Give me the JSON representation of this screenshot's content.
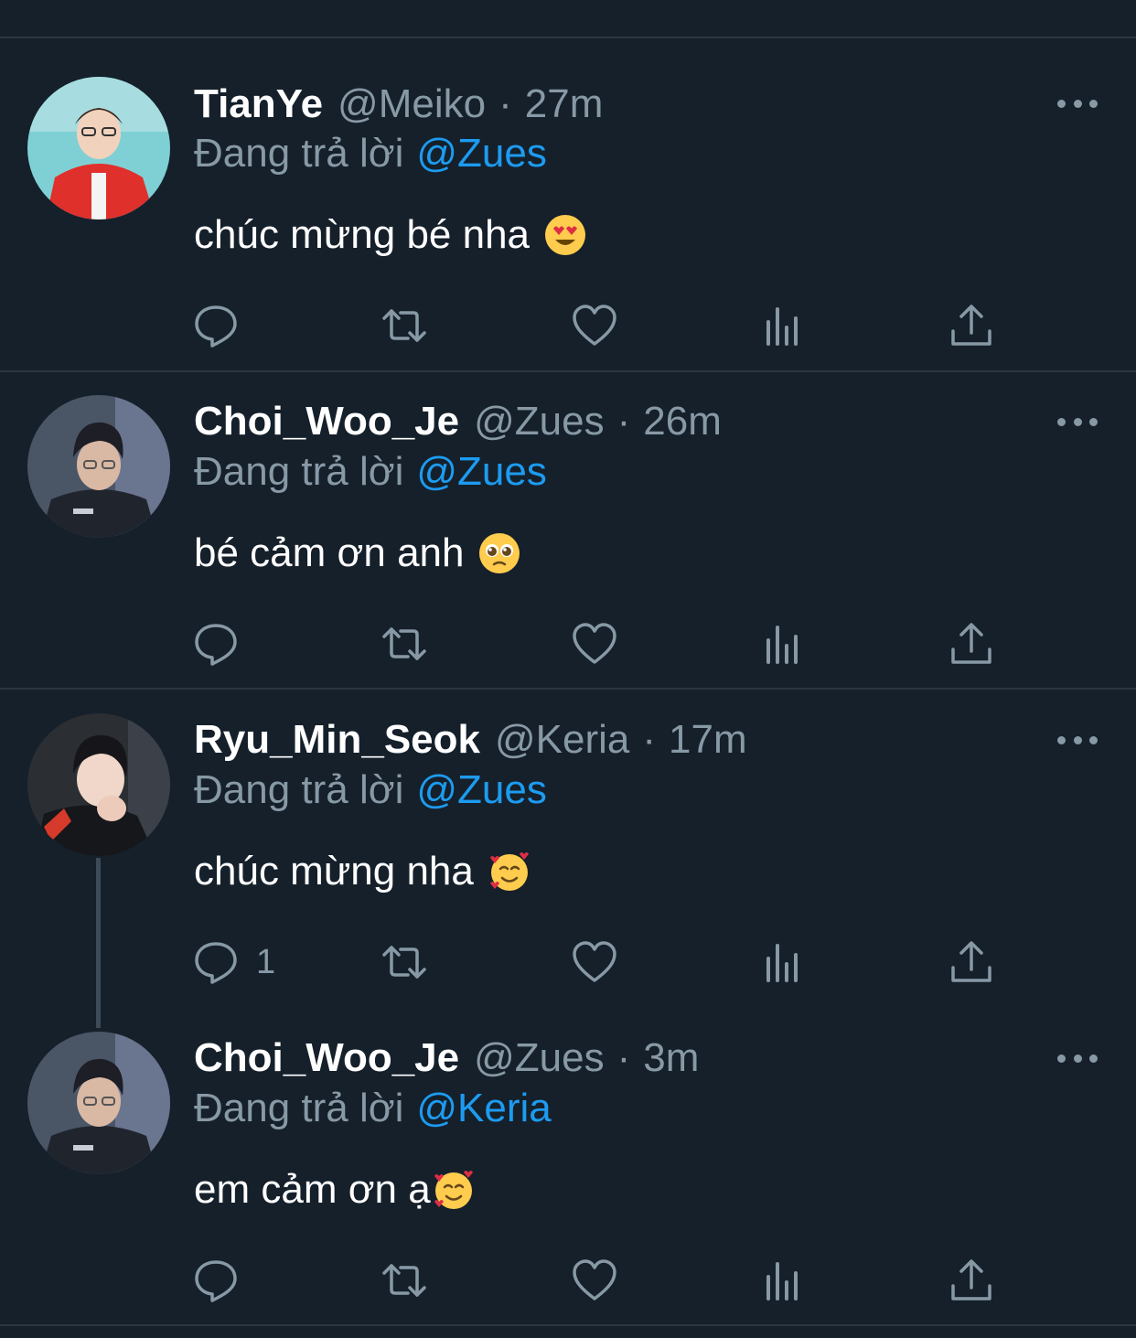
{
  "replying_label": "Đang trả lời",
  "colors": {
    "background": "#15202b",
    "muted": "#8899a6",
    "link": "#1d9bf0",
    "divider": "#2c3640"
  },
  "tweets": [
    {
      "name": "TianYe",
      "handle": "@Meiko",
      "dot": "·",
      "time": "27m",
      "replying_to": "@Zues",
      "text": "chúc mừng bé nha",
      "emoji": "heart-eyes-emoji",
      "reply_count": ""
    },
    {
      "name": "Choi_Woo_Je",
      "handle": "@Zues",
      "dot": "·",
      "time": "26m",
      "replying_to": "@Zues",
      "text": "bé cảm ơn anh",
      "emoji": "pleading-face-emoji",
      "reply_count": ""
    },
    {
      "name": "Ryu_Min_Seok",
      "handle": "@Keria",
      "dot": "·",
      "time": "17m",
      "replying_to": "@Zues",
      "text": "chúc mừng nha",
      "emoji": "smiling-face-with-hearts-emoji",
      "reply_count": "1"
    },
    {
      "name": "Choi_Woo_Je",
      "handle": "@Zues",
      "dot": "·",
      "time": "3m",
      "replying_to": "@Keria",
      "text": "em cảm ơn ạ",
      "emoji": "smiling-face-with-hearts-emoji",
      "reply_count": ""
    }
  ],
  "action_icons": [
    "reply-icon",
    "retweet-icon",
    "like-icon",
    "analytics-icon",
    "share-icon"
  ]
}
